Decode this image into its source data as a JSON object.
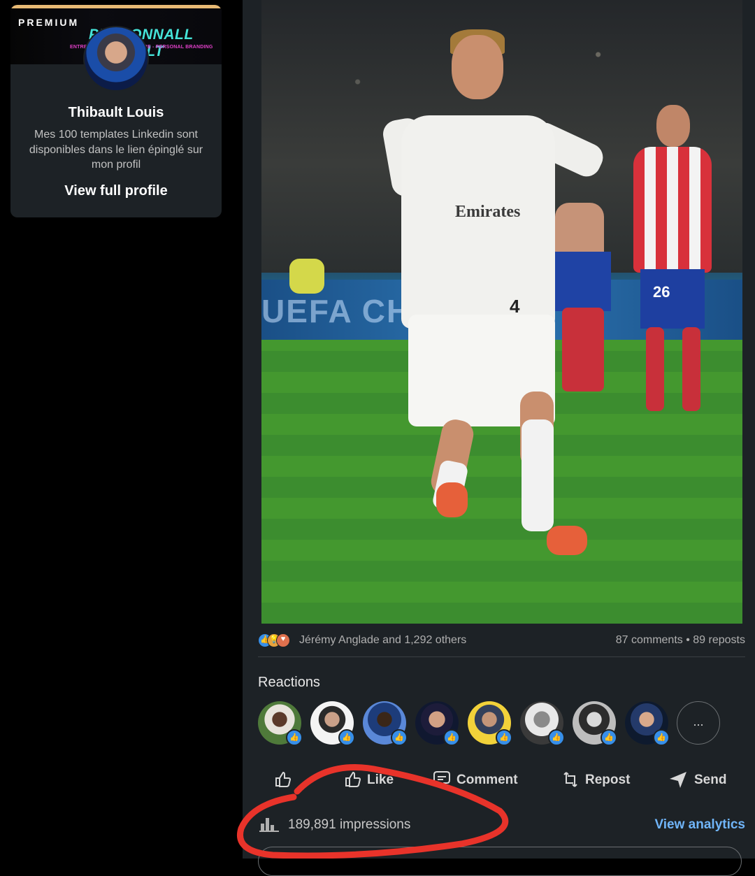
{
  "profile": {
    "premium_label": "PREMIUM",
    "banner_title": "PERSONNALL THIBAULT",
    "banner_subtitle": "ENTREPRENEURIAT - ÉCRITURE - PERSONAL BRANDING",
    "name": "Thibault Louis",
    "headline": "Mes 100 templates Linkedin sont disponibles dans le lien épinglé sur mon profil",
    "view_profile_label": "View full profile"
  },
  "post": {
    "photo_jersey_text": "Emirates",
    "photo_jersey_number": "4",
    "photo_board_text": "UEFA CHA",
    "photo_atletico_number": "26",
    "reaction_icons": [
      "like-icon",
      "insightful-icon",
      "love-icon"
    ],
    "likers_text": "Jérémy Anglade and 1,292 others",
    "comments_text": "87 comments",
    "counts_separator": " • ",
    "reposts_text": "89 reposts",
    "reactions_title": "Reactions",
    "reactors_count": 8,
    "more_label": "...",
    "actions": {
      "like": "Like",
      "comment": "Comment",
      "repost": "Repost",
      "send": "Send"
    },
    "impressions_text": "189,891 impressions",
    "view_analytics_label": "View analytics"
  },
  "colors": {
    "panel_bg": "#1d2226",
    "accent_blue": "#70b5f9",
    "premium_gold": "#e7b974",
    "annotation_red": "#e8332a"
  }
}
